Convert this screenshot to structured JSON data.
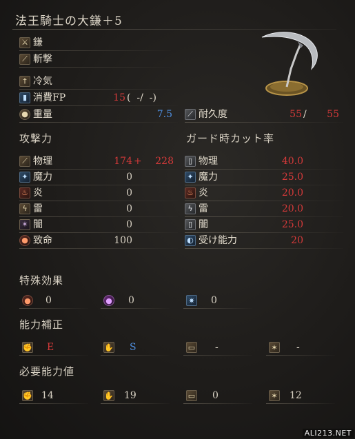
{
  "weapon": {
    "name": "法王騎士の大鎌＋5"
  },
  "basic": {
    "type_label": "鎌",
    "attack_type_label": "斬撃",
    "skill_label": "冷気",
    "fp_label": "消費FP",
    "fp_value": "15",
    "fp_extra": "(  -/  -)",
    "weight_label": "重量",
    "weight_value": "7.5",
    "durability_label": "耐久度",
    "durability_current": "55",
    "durability_sep": "/",
    "durability_max": "55"
  },
  "attack": {
    "title": "攻撃力",
    "physical_label": "物理",
    "physical_base": "174",
    "physical_plus": "+",
    "physical_total": "228",
    "magic_label": "魔力",
    "magic_value": "0",
    "fire_label": "炎",
    "fire_value": "0",
    "lightning_label": "雷",
    "lightning_value": "0",
    "dark_label": "闇",
    "dark_value": "0",
    "critical_label": "致命",
    "critical_value": "100"
  },
  "guard": {
    "title": "ガード時カット率",
    "physical_label": "物理",
    "physical_value": "40.0",
    "magic_label": "魔力",
    "magic_value": "25.0",
    "fire_label": "炎",
    "fire_value": "20.0",
    "lightning_label": "雷",
    "lightning_value": "20.0",
    "dark_label": "闇",
    "dark_value": "25.0",
    "stability_label": "受け能力",
    "stability_value": "20"
  },
  "effects": {
    "title": "特殊効果",
    "bleed_value": "0",
    "poison_value": "0",
    "frost_value": "0"
  },
  "scaling": {
    "title": "能力補正",
    "str": "E",
    "dex": "S",
    "int": "-",
    "fth": "-"
  },
  "requirements": {
    "title": "必要能力値",
    "str": "14",
    "dex": "19",
    "int": "0",
    "fth": "12"
  },
  "watermark": "ALI213.NET"
}
